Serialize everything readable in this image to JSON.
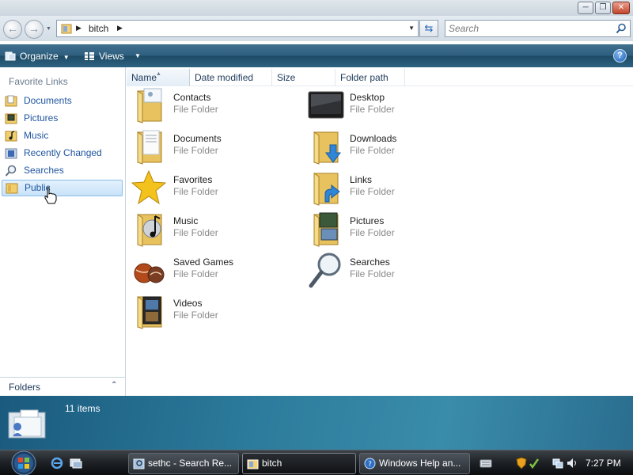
{
  "window": {
    "minimize_glyph": "─",
    "maximize_glyph": "❐",
    "close_glyph": "✕"
  },
  "address": {
    "path_segment": "bitch",
    "search_placeholder": "Search",
    "back_glyph": "←",
    "forward_glyph": "→",
    "refresh_glyph": "⇆"
  },
  "commandbar": {
    "organize_label": "Organize",
    "views_label": "Views",
    "help_glyph": "?"
  },
  "navpane": {
    "header": "Favorite Links",
    "items": [
      {
        "label": "Documents",
        "icon": "documents-icon"
      },
      {
        "label": "Pictures",
        "icon": "pictures-icon"
      },
      {
        "label": "Music",
        "icon": "music-icon"
      },
      {
        "label": "Recently Changed",
        "icon": "recently-changed-icon"
      },
      {
        "label": "Searches",
        "icon": "search-icon"
      },
      {
        "label": "Public",
        "icon": "public-folder-icon",
        "selected": true
      }
    ],
    "folders_label": "Folders",
    "folders_chevron": "⌃"
  },
  "columns": {
    "name": "Name",
    "date_modified": "Date modified",
    "size": "Size",
    "folder_path": "Folder path"
  },
  "items": [
    {
      "name": "Contacts",
      "type": "File Folder",
      "icon": "contacts-folder-icon"
    },
    {
      "name": "Desktop",
      "type": "File Folder",
      "icon": "desktop-icon"
    },
    {
      "name": "Documents",
      "type": "File Folder",
      "icon": "documents-folder-icon"
    },
    {
      "name": "Downloads",
      "type": "File Folder",
      "icon": "downloads-folder-icon"
    },
    {
      "name": "Favorites",
      "type": "File Folder",
      "icon": "favorites-star-icon"
    },
    {
      "name": "Links",
      "type": "File Folder",
      "icon": "links-folder-icon"
    },
    {
      "name": "Music",
      "type": "File Folder",
      "icon": "music-folder-icon"
    },
    {
      "name": "Pictures",
      "type": "File Folder",
      "icon": "pictures-folder-icon"
    },
    {
      "name": "Saved Games",
      "type": "File Folder",
      "icon": "saved-games-icon"
    },
    {
      "name": "Searches",
      "type": "File Folder",
      "icon": "searches-magnifier-icon"
    },
    {
      "name": "Videos",
      "type": "File Folder",
      "icon": "videos-folder-icon"
    }
  ],
  "details": {
    "item_count": "11 items"
  },
  "taskbar": {
    "tasks": [
      {
        "label": "sethc - Search Re...",
        "icon": "search-folder-icon"
      },
      {
        "label": "bitch",
        "icon": "folder-icon",
        "active": true
      },
      {
        "label": "Windows Help an...",
        "icon": "help-icon"
      }
    ],
    "clock": "7:27 PM"
  },
  "colors": {
    "command_bar": "#2f5f7f",
    "details_pane": "#2c7b9c",
    "link_text": "#1f55a0",
    "taskbar": "#1d2125"
  }
}
